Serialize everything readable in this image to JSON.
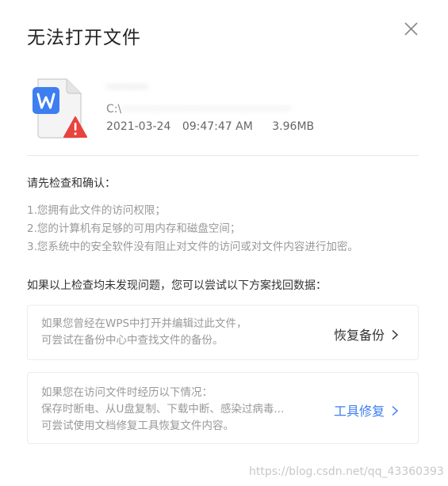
{
  "dialog": {
    "title": "无法打开文件"
  },
  "file": {
    "name": "···········",
    "path_prefix": "C:\\",
    "path_tail": "················································",
    "date": "2021-03-24",
    "time": "09:47:47 AM",
    "size": "3.96MB",
    "icon": "wps-writer-file-warning-icon"
  },
  "checks": {
    "title": "请先检查和确认：",
    "items": [
      "1.您拥有此文件的访问权限；",
      "2.您的计算机有足够的可用内存和磁盘空间；",
      "3.您系统中的安全软件没有阻止对文件的访问或对文件内容进行加密。"
    ]
  },
  "recovery": {
    "title": "如果以上检查均未发现问题，您可以尝试以下方案找回数据：",
    "cards": [
      {
        "lines": [
          "如果您曾经在WPS中打开并编辑过此文件，",
          "可尝试在备份中心中查找文件的备份。"
        ],
        "action": "恢复备份"
      },
      {
        "lines": [
          "如果您在访问文件时经历以下情况：",
          "保存时断电、从U盘复制、下载中断、感染过病毒...",
          "可尝试使用文档修复工具恢复文件内容。"
        ],
        "action": "工具修复"
      }
    ]
  },
  "watermark": "https://blog.csdn.net/qq_43360393",
  "colors": {
    "accent": "#3c7ef3",
    "wps_blue": "#3d7ff0",
    "warning_red": "#e8433e"
  }
}
